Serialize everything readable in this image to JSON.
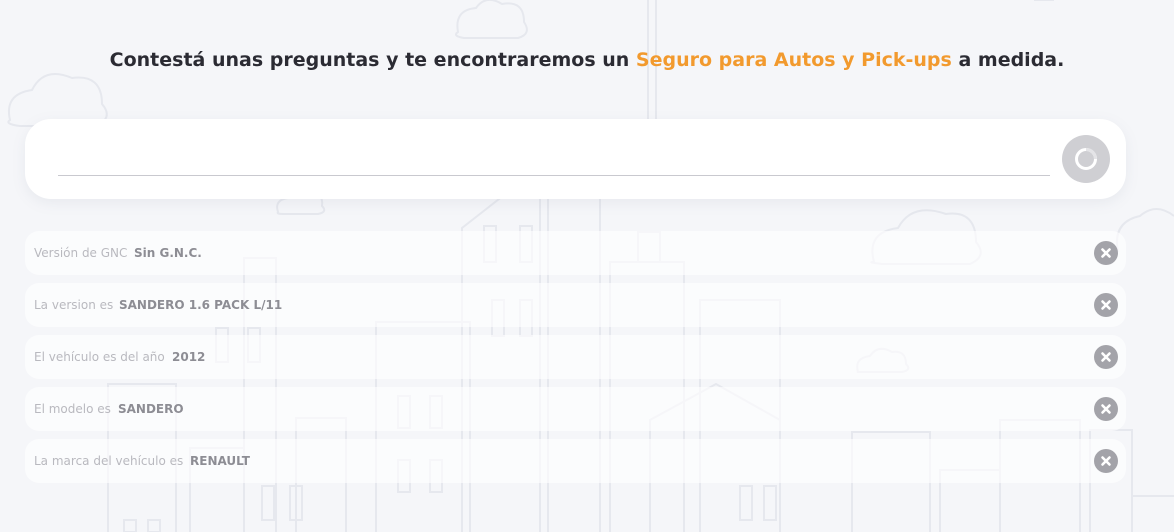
{
  "headline": {
    "before": "Contestá unas preguntas y te encontraremos un ",
    "highlight": "Seguro para Autos y Pick-ups",
    "after": " a medida."
  },
  "search": {
    "value": "",
    "placeholder": ""
  },
  "submit": {
    "icon": "loading-ring-icon"
  },
  "answers": [
    {
      "question": "Versión de GNC",
      "answer": "Sin G.N.C.",
      "remove_icon": "close-icon"
    },
    {
      "question": "La version es",
      "answer": "SANDERO 1.6 PACK L/11",
      "remove_icon": "close-icon"
    },
    {
      "question": "El vehículo es del año",
      "answer": "2012",
      "remove_icon": "close-icon"
    },
    {
      "question": "El modelo es",
      "answer": "SANDERO",
      "remove_icon": "close-icon"
    },
    {
      "question": "La marca del vehículo es",
      "answer": "RENAULT",
      "remove_icon": "close-icon"
    }
  ],
  "colors": {
    "background": "#f5f6f9",
    "accent": "#f29a2e",
    "heading": "#2b2b33",
    "question_text": "#b9b9bf",
    "answer_text": "#8d8d94",
    "remove_button": "#a3a3a9",
    "submit_button": "#cfcfd3"
  }
}
